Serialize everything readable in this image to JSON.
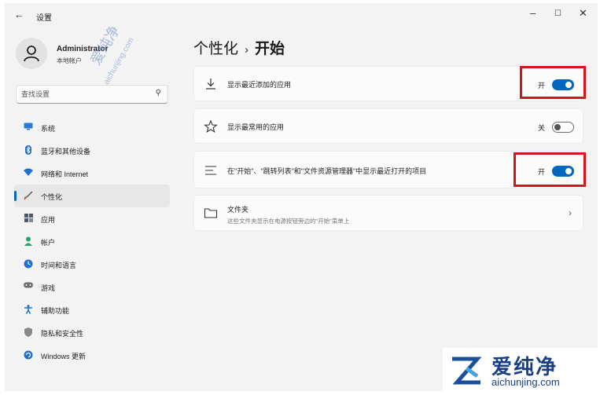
{
  "window": {
    "title": "设置",
    "back": "←",
    "min": "–",
    "max": "☐",
    "close": "✕"
  },
  "user": {
    "name": "Administrator",
    "account_type": "本地帐户"
  },
  "search": {
    "placeholder": "查找设置",
    "icon": "search-icon"
  },
  "nav": [
    {
      "label": "系统",
      "icon": "monitor-icon",
      "color": "#2b79d4"
    },
    {
      "label": "蓝牙和其他设备",
      "icon": "bluetooth-icon",
      "color": "#1f6fd0"
    },
    {
      "label": "网络和 Internet",
      "icon": "wifi-icon",
      "color": "#1f6fd0"
    },
    {
      "label": "个性化",
      "icon": "brush-icon",
      "color": "#c4532e",
      "active": true
    },
    {
      "label": "应用",
      "icon": "apps-icon",
      "color": "#4c5a6b"
    },
    {
      "label": "帐户",
      "icon": "person-icon",
      "color": "#2aa36b"
    },
    {
      "label": "时间和语言",
      "icon": "globe-clock-icon",
      "color": "#1f6fd0"
    },
    {
      "label": "游戏",
      "icon": "gamepad-icon",
      "color": "#6e6e6e"
    },
    {
      "label": "辅助功能",
      "icon": "accessibility-icon",
      "color": "#1f6fd0"
    },
    {
      "label": "隐私和安全性",
      "icon": "shield-icon",
      "color": "#6e6e6e"
    },
    {
      "label": "Windows 更新",
      "icon": "update-icon",
      "color": "#1f6fd0"
    }
  ],
  "breadcrumb": {
    "parent": "个性化",
    "separator": "›",
    "current": "开始"
  },
  "settings": [
    {
      "label": "显示最近添加的应用",
      "state": "开",
      "on": true,
      "icon": "download-icon"
    },
    {
      "label": "显示最常用的应用",
      "state": "关",
      "on": false,
      "icon": "star-icon"
    },
    {
      "label": "在\"开始\"、\"跳转列表\"和\"文件资源管理器\"中显示最近打开的项目",
      "state": "开",
      "on": true,
      "icon": "list-icon"
    }
  ],
  "folders": {
    "title": "文件夹",
    "subtitle": "这些文件夹显示在电源按钮旁边的\"开始\"菜单上",
    "icon": "folder-icon",
    "chevron": "›"
  },
  "watermark": {
    "brand": "爱纯净",
    "url": "aichunjing.com"
  },
  "colors": {
    "accent": "#0067c0",
    "highlight": "#d6141f"
  }
}
